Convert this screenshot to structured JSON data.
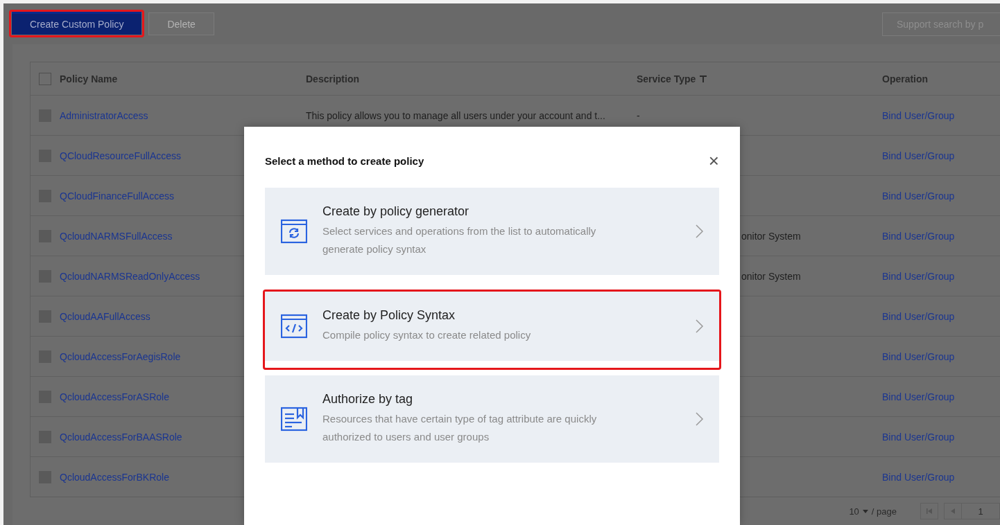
{
  "toolbar": {
    "create_button": {
      "label": "Create Custom Policy",
      "highlighted": true
    },
    "delete_button": {
      "label": "Delete",
      "disabled": true
    },
    "search": {
      "placeholder": "Support search by p"
    }
  },
  "table": {
    "columns": [
      {
        "label": "Policy Name",
        "kind": "check"
      },
      {
        "label": "Description",
        "kind": "plain"
      },
      {
        "label": "Service Type",
        "kind": "filter"
      },
      {
        "label": "Operation",
        "kind": "plain"
      }
    ],
    "header_checkbox": {
      "checked": false,
      "disabled": false
    },
    "rows": [
      {
        "name": "AdministratorAccess",
        "description": "This policy allows you to manage all users under your account and t...",
        "service_type": "-",
        "service_cut": false,
        "operation": "Bind User/Group",
        "checked": false,
        "disabled": true
      },
      {
        "name": "QCloudResourceFullAccess",
        "operation": "Bind User/Group",
        "checked": false,
        "disabled": true
      },
      {
        "name": "QCloudFinanceFullAccess",
        "operation": "Bind User/Group",
        "checked": false,
        "disabled": true
      },
      {
        "name": "QcloudNARMSFullAccess",
        "service_type": "onitor System",
        "service_cut": true,
        "operation": "Bind User/Group",
        "checked": false,
        "disabled": true
      },
      {
        "name": "QcloudNARMSReadOnlyAccess",
        "service_type": "onitor System",
        "service_cut": true,
        "operation": "Bind User/Group",
        "checked": false,
        "disabled": true
      },
      {
        "name": "QcloudAAFullAccess",
        "operation": "Bind User/Group",
        "checked": false,
        "disabled": true
      },
      {
        "name": "QcloudAccessForAegisRole",
        "operation": "Bind User/Group",
        "checked": false,
        "disabled": true
      },
      {
        "name": "QcloudAccessForASRole",
        "operation": "Bind User/Group",
        "checked": false,
        "disabled": true
      },
      {
        "name": "QcloudAccessForBAASRole",
        "operation": "Bind User/Group",
        "checked": false,
        "disabled": true
      },
      {
        "name": "QcloudAccessForBKRole",
        "operation": "Bind User/Group",
        "checked": false,
        "disabled": true
      }
    ]
  },
  "pagination": {
    "page_size": "10",
    "per_page_label": "/ page",
    "page": "1"
  },
  "modal": {
    "title": "Select a method to create policy",
    "close": "×",
    "options": [
      {
        "kind": "generator",
        "title": "Create by policy generator",
        "description": "Select services and operations from the list to automatically generate policy syntax",
        "highlighted": false
      },
      {
        "kind": "syntax",
        "title": "Create by Policy Syntax",
        "description": "Compile policy syntax to create related policy",
        "highlighted": true
      },
      {
        "kind": "tag",
        "title": "Authorize by tag",
        "description": "Resources that have certain type of tag attribute are quickly authorized to users and user groups",
        "highlighted": false
      }
    ]
  }
}
